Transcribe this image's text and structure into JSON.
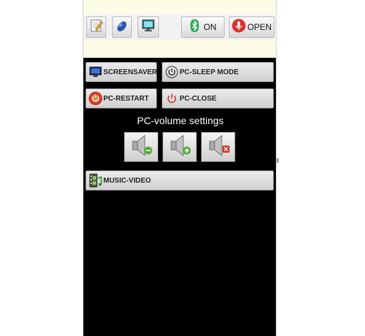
{
  "toolbar": {
    "icons": [
      "notepad-icon",
      "mouse-icon",
      "monitor-icon"
    ],
    "bluetooth": {
      "icon": "bluetooth-icon",
      "label": "ON"
    },
    "microphone": {
      "icon": "microphone-icon",
      "label": "OPEN"
    }
  },
  "buttons": {
    "screensaver": {
      "label": "SCREENSAVER",
      "icon": "monitor-icon"
    },
    "sleep": {
      "label": "PC-SLEEP MODE",
      "icon": "power-icon"
    },
    "restart": {
      "label": "PC-RESTART",
      "icon": "restart-icon"
    },
    "close": {
      "label": "PC-CLOSE",
      "icon": "power-icon"
    },
    "music_video": {
      "label": "MUSIC-VIDEO",
      "icon": "film-music-icon"
    }
  },
  "volume": {
    "title": "PC-volume settings",
    "buttons": [
      "volume-down-icon",
      "volume-up-icon",
      "volume-mute-icon"
    ]
  },
  "colors": {
    "app_background": "#fcfce6",
    "panel_background": "#000000",
    "accent_red": "#d9322b",
    "accent_green": "#4caf2a"
  }
}
